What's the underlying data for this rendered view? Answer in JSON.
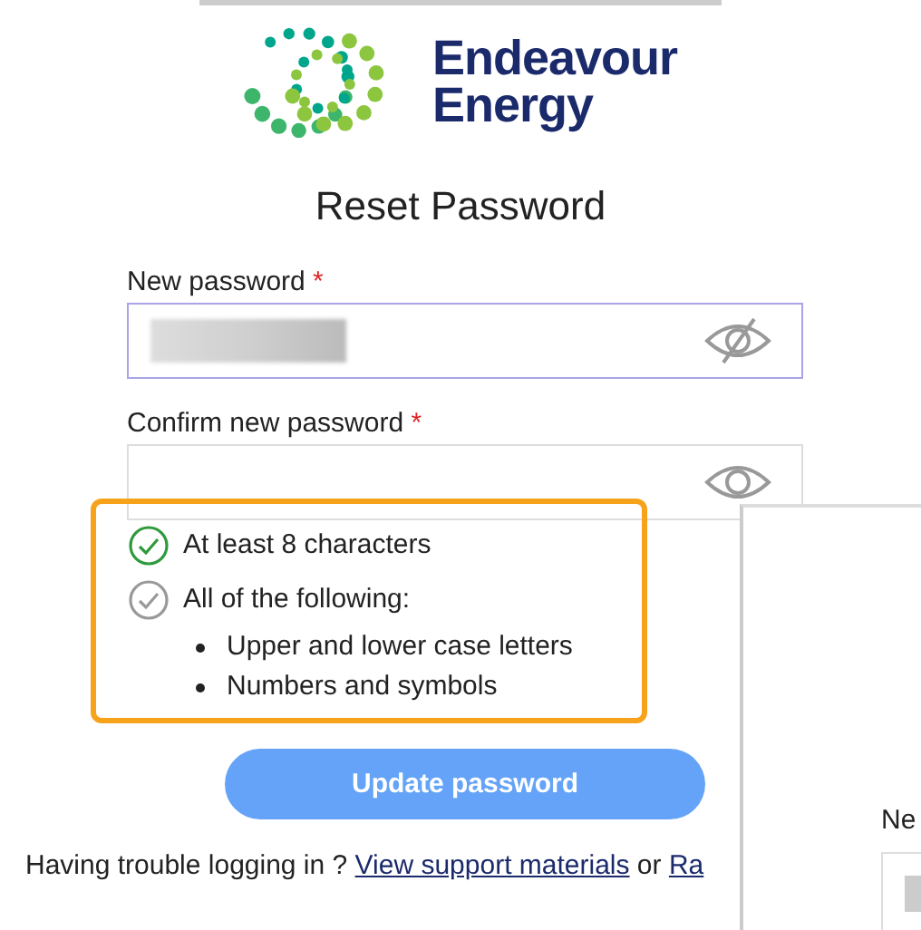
{
  "logo": {
    "lines": [
      "Endeavour",
      "Energy"
    ]
  },
  "title": "Reset Password",
  "fields": [
    {
      "label": "New password",
      "required_mark": "*",
      "focused": true,
      "filled": true,
      "eye_slashed": true
    },
    {
      "label": "Confirm new password",
      "required_mark": "*",
      "focused": false,
      "filled": false,
      "eye_slashed": false
    }
  ],
  "rules": {
    "highlighted": true,
    "items": [
      {
        "text": "At least 8 characters",
        "met": true
      },
      {
        "text": "All of the following:",
        "met": false,
        "bullets": [
          "Upper and lower case letters",
          "Numbers and symbols"
        ]
      }
    ]
  },
  "button": {
    "label": "Update password",
    "disabled": true
  },
  "footer": {
    "text": "Having trouble logging in ?",
    "link": "View support materials",
    "joiner": "or",
    "link_2": "Ra"
  },
  "overlay_panel": {
    "label": "Ne",
    "field_filled": true
  }
}
